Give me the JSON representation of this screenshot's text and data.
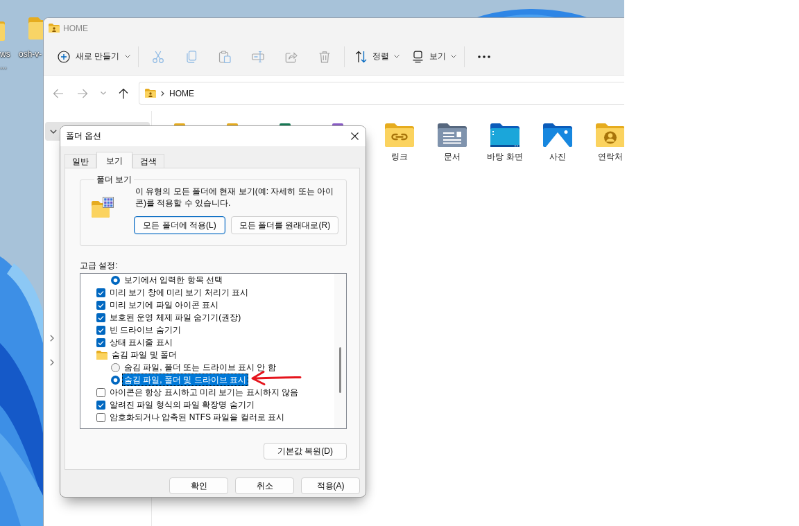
{
  "desktop": {
    "icons": [
      {
        "lines": [
          "ws",
          "..."
        ]
      },
      {
        "lines": [
          "osh-v-"
        ]
      }
    ]
  },
  "explorer": {
    "title": "HOME",
    "command_bar": {
      "groups": [
        [
          {
            "kind": "new",
            "label": "새로 만들기",
            "dropdown": true,
            "disabled": false
          }
        ],
        [
          {
            "kind": "cut",
            "dropdown": false,
            "disabled": true
          },
          {
            "kind": "copy",
            "dropdown": false,
            "disabled": true
          },
          {
            "kind": "paste",
            "dropdown": false,
            "disabled": true
          },
          {
            "kind": "rename",
            "dropdown": false,
            "disabled": true
          },
          {
            "kind": "share",
            "dropdown": false,
            "disabled": true
          },
          {
            "kind": "delete",
            "dropdown": false,
            "disabled": true
          }
        ],
        [
          {
            "kind": "sort",
            "label": "정렬",
            "dropdown": true,
            "disabled": false
          },
          {
            "kind": "view",
            "label": "보기",
            "dropdown": true,
            "disabled": false
          }
        ],
        [
          {
            "kind": "more",
            "dropdown": false,
            "disabled": false
          }
        ]
      ]
    },
    "navigation": [
      {
        "kind": "back",
        "disabled": true
      },
      {
        "kind": "forward",
        "disabled": true
      },
      {
        "kind": "recent",
        "disabled": true
      },
      {
        "kind": "up",
        "disabled": false
      }
    ],
    "address_bar": {
      "path": [
        "HOME"
      ]
    },
    "nav_pane": {
      "items": [
        {
          "expanded": true,
          "selected": true
        },
        {
          "expanded": false,
          "selected": false
        },
        {
          "expanded": false,
          "selected": false
        }
      ]
    },
    "files": [
      {
        "kind": "covered",
        "color": "#e6ac1f"
      },
      {
        "kind": "covered",
        "color": "#e6ac1f"
      },
      {
        "kind": "covered",
        "color": "#187a56"
      },
      {
        "kind": "covered",
        "color": "#8a5cc6"
      },
      {
        "kind": "links",
        "label": "링크"
      },
      {
        "kind": "documents",
        "label": "문서"
      },
      {
        "kind": "desktop",
        "label": "바탕 화면"
      },
      {
        "kind": "pictures",
        "label": "사진"
      },
      {
        "kind": "contacts",
        "label": "연락처"
      }
    ]
  },
  "dialog": {
    "title": "폴더 옵션",
    "tabs": [
      {
        "label": "일반",
        "selected": false
      },
      {
        "label": "보기",
        "selected": true
      },
      {
        "label": "검색",
        "selected": false
      }
    ],
    "folder_views": {
      "title": "폴더 보기",
      "description": "이 유형의 모든 폴더에 현재 보기(예: 자세히 또는 아이콘)를 적용할 수 있습니다.",
      "buttons": [
        {
          "label": "모든 폴더에 적용(L)",
          "default": true
        },
        {
          "label": "모든 폴더를 원래대로(R)",
          "default": false
        }
      ]
    },
    "advanced_settings": {
      "label": "고급 설정:",
      "items": [
        {
          "kind": "group",
          "children": [
            {
              "kind": "radio",
              "label": "보기에서 입력한 항목 선택",
              "checked": true,
              "selected": false
            }
          ]
        },
        {
          "kind": "checkbox",
          "label": "미리 보기 창에 미리 보기 처리기 표시",
          "checked": true,
          "selected": false
        },
        {
          "kind": "checkbox",
          "label": "미리 보기에 파일 아이콘 표시",
          "checked": true,
          "selected": false
        },
        {
          "kind": "checkbox",
          "label": "보호된 운영 체제 파일 숨기기(권장)",
          "checked": true,
          "selected": false
        },
        {
          "kind": "checkbox",
          "label": "빈 드라이브 숨기기",
          "checked": true,
          "selected": false
        },
        {
          "kind": "checkbox",
          "label": "상태 표시줄 표시",
          "checked": true,
          "selected": false
        },
        {
          "kind": "folder",
          "label": "숨김 파일 및 폴더",
          "selected": false,
          "children": [
            {
              "kind": "radio",
              "label": "숨김 파일, 폴더 또는 드라이브 표시 안 함",
              "checked": false,
              "selected": false
            },
            {
              "kind": "radio",
              "label": "숨김 파일, 폴더 및 드라이브 표시",
              "checked": true,
              "selected": true
            }
          ]
        },
        {
          "kind": "checkbox",
          "label": "아이콘은 항상 표시하고 미리 보기는 표시하지 않음",
          "checked": false,
          "selected": false
        },
        {
          "kind": "checkbox",
          "label": "알려진 파일 형식의 파일 확장명 숨기기",
          "checked": true,
          "selected": false
        },
        {
          "kind": "checkbox",
          "label": "암호화되거나 압축된 NTFS 파일을 컬러로 표시",
          "checked": false,
          "selected": false
        }
      ]
    },
    "restore_button": "기본값 복원(D)",
    "buttons": [
      {
        "label": "확인"
      },
      {
        "label": "취소"
      },
      {
        "label": "적용(A)"
      }
    ]
  }
}
